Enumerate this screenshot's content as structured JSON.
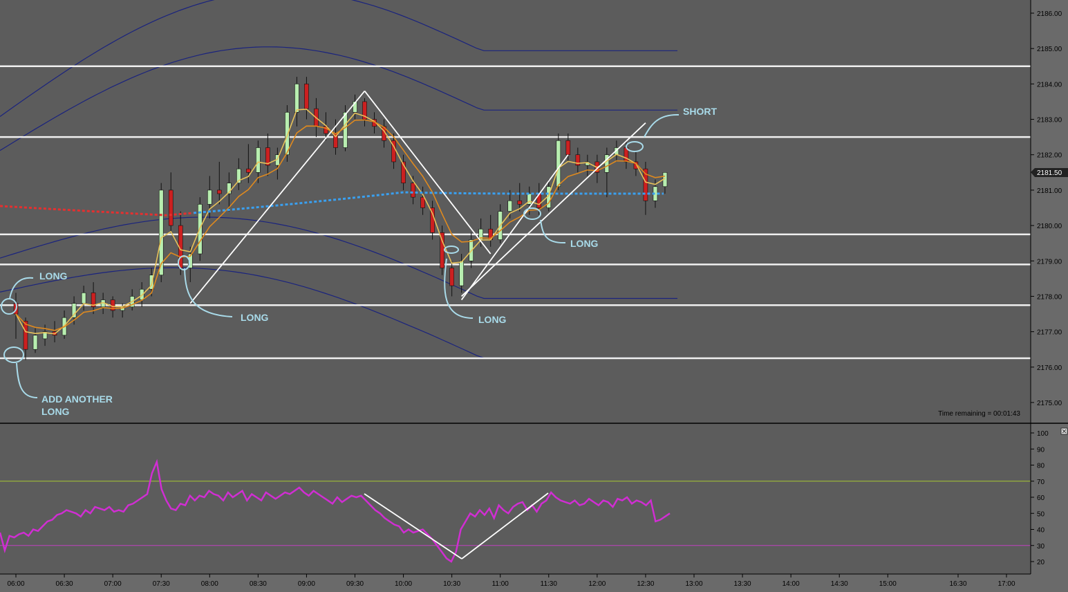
{
  "chart_data": [
    {
      "type": "candlestick",
      "title": "",
      "ylim": [
        2174.5,
        2186.3
      ],
      "x_labels": [
        "06:00",
        "06:30",
        "07:00",
        "07:30",
        "08:00",
        "08:30",
        "09:00",
        "09:30",
        "10:00",
        "10:30",
        "11:00",
        "11:30",
        "12:00",
        "12:30",
        "13:00",
        "13:30",
        "14:00",
        "14:30",
        "15:00",
        "16:30",
        "17:00"
      ],
      "y_ticks": [
        "2175.00",
        "2176.00",
        "2177.00",
        "2178.00",
        "2179.00",
        "2180.00",
        "2181.00",
        "2182.00",
        "2183.00",
        "2184.00",
        "2185.00",
        "2186.00"
      ],
      "last_price": "2181.50",
      "status_text": "Time remaining = 00:01:43",
      "horizontal_levels": [
        2184.5,
        2182.5,
        2179.75,
        2178.9,
        2177.75,
        2176.25
      ],
      "annotations": [
        "LONG",
        "LONG",
        "ADD ANOTHER",
        "LONG",
        "LONG",
        "LONG",
        "SHORT"
      ],
      "bars": [
        [
          "06:00",
          2177.8,
          2178.1,
          2176.8,
          2177.5
        ],
        [
          "06:06",
          2177.3,
          2177.4,
          2176.2,
          2176.5
        ],
        [
          "06:12",
          2176.5,
          2177.1,
          2176.4,
          2176.9
        ],
        [
          "06:18",
          2176.8,
          2177.2,
          2176.6,
          2177.0
        ],
        [
          "06:24",
          2177.0,
          2177.3,
          2176.7,
          2176.9
        ],
        [
          "06:30",
          2176.9,
          2177.6,
          2176.8,
          2177.4
        ],
        [
          "06:36",
          2177.4,
          2178.0,
          2177.2,
          2177.8
        ],
        [
          "06:42",
          2177.8,
          2178.3,
          2177.6,
          2178.1
        ],
        [
          "06:48",
          2178.1,
          2178.4,
          2177.5,
          2177.7
        ],
        [
          "06:54",
          2177.7,
          2178.1,
          2177.5,
          2177.9
        ],
        [
          "07:00",
          2177.9,
          2178.0,
          2177.4,
          2177.6
        ],
        [
          "07:06",
          2177.6,
          2177.8,
          2177.4,
          2177.7
        ],
        [
          "07:12",
          2177.7,
          2178.2,
          2177.6,
          2178.0
        ],
        [
          "07:18",
          2177.9,
          2178.4,
          2177.7,
          2178.2
        ],
        [
          "07:24",
          2178.2,
          2178.8,
          2178.0,
          2178.6
        ],
        [
          "07:30",
          2178.6,
          2181.2,
          2178.4,
          2181.0
        ],
        [
          "07:36",
          2181.0,
          2181.5,
          2179.8,
          2180.0
        ],
        [
          "07:42",
          2180.0,
          2180.4,
          2178.6,
          2178.8
        ],
        [
          "07:48",
          2178.8,
          2179.4,
          2178.4,
          2179.2
        ],
        [
          "07:54",
          2179.2,
          2180.8,
          2179.0,
          2180.6
        ],
        [
          "08:00",
          2180.6,
          2181.4,
          2180.2,
          2181.0
        ],
        [
          "08:06",
          2181.0,
          2181.8,
          2180.6,
          2180.9
        ],
        [
          "08:12",
          2180.9,
          2181.5,
          2180.4,
          2181.2
        ],
        [
          "08:18",
          2181.2,
          2181.9,
          2181.0,
          2181.6
        ],
        [
          "08:24",
          2181.6,
          2182.3,
          2181.2,
          2181.5
        ],
        [
          "08:30",
          2181.5,
          2182.4,
          2181.2,
          2182.2
        ],
        [
          "08:36",
          2182.2,
          2182.6,
          2181.4,
          2181.7
        ],
        [
          "08:42",
          2181.7,
          2182.2,
          2181.3,
          2182.0
        ],
        [
          "08:48",
          2182.0,
          2183.4,
          2181.8,
          2183.2
        ],
        [
          "08:54",
          2183.2,
          2184.2,
          2182.8,
          2184.0
        ],
        [
          "09:00",
          2184.0,
          2184.2,
          2183.0,
          2183.3
        ],
        [
          "09:06",
          2183.3,
          2183.6,
          2182.5,
          2182.8
        ],
        [
          "09:12",
          2182.8,
          2183.2,
          2182.4,
          2182.6
        ],
        [
          "09:18",
          2182.6,
          2183.0,
          2182.0,
          2182.2
        ],
        [
          "09:24",
          2182.2,
          2183.4,
          2182.1,
          2183.2
        ],
        [
          "09:30",
          2183.2,
          2183.7,
          2183.0,
          2183.5
        ],
        [
          "09:36",
          2183.5,
          2183.6,
          2182.8,
          2183.0
        ],
        [
          "09:42",
          2183.0,
          2183.2,
          2182.6,
          2182.8
        ],
        [
          "09:48",
          2182.8,
          2183.0,
          2182.2,
          2182.4
        ],
        [
          "09:54",
          2182.4,
          2182.6,
          2181.6,
          2181.8
        ],
        [
          "10:00",
          2181.8,
          2182.0,
          2181.0,
          2181.2
        ],
        [
          "10:06",
          2181.2,
          2181.4,
          2180.6,
          2180.8
        ],
        [
          "10:12",
          2180.8,
          2181.1,
          2180.3,
          2180.5
        ],
        [
          "10:18",
          2180.5,
          2180.7,
          2179.6,
          2179.8
        ],
        [
          "10:24",
          2179.8,
          2180.0,
          2178.6,
          2178.8
        ],
        [
          "10:30",
          2178.8,
          2179.0,
          2178.0,
          2178.3
        ],
        [
          "10:36",
          2178.3,
          2179.2,
          2178.1,
          2179.0
        ],
        [
          "10:42",
          2179.0,
          2179.8,
          2178.8,
          2179.6
        ],
        [
          "10:48",
          2179.6,
          2180.2,
          2179.4,
          2179.9
        ],
        [
          "10:54",
          2179.9,
          2180.3,
          2179.4,
          2179.6
        ],
        [
          "11:00",
          2179.6,
          2180.6,
          2179.5,
          2180.4
        ],
        [
          "11:06",
          2180.4,
          2181.0,
          2180.2,
          2180.7
        ],
        [
          "11:12",
          2180.7,
          2181.2,
          2180.4,
          2180.6
        ],
        [
          "11:18",
          2180.6,
          2181.1,
          2180.3,
          2180.9
        ],
        [
          "11:24",
          2180.9,
          2181.2,
          2180.3,
          2180.5
        ],
        [
          "11:30",
          2180.5,
          2181.3,
          2180.4,
          2181.1
        ],
        [
          "11:36",
          2181.1,
          2182.6,
          2181.0,
          2182.4
        ],
        [
          "11:42",
          2182.4,
          2182.6,
          2181.8,
          2182.0
        ],
        [
          "11:48",
          2182.0,
          2182.2,
          2181.5,
          2181.7
        ],
        [
          "11:54",
          2181.7,
          2182.0,
          2181.4,
          2181.8
        ],
        [
          "12:00",
          2181.8,
          2182.0,
          2181.2,
          2181.5
        ],
        [
          "12:06",
          2181.5,
          2182.2,
          2180.8,
          2182.0
        ],
        [
          "12:12",
          2182.0,
          2182.4,
          2181.8,
          2182.2
        ],
        [
          "12:18",
          2182.2,
          2182.4,
          2181.6,
          2181.8
        ],
        [
          "12:24",
          2181.8,
          2182.1,
          2181.4,
          2181.6
        ],
        [
          "12:30",
          2181.6,
          2181.8,
          2180.3,
          2180.7
        ],
        [
          "12:36",
          2180.7,
          2181.3,
          2180.5,
          2181.1
        ],
        [
          "12:42",
          2181.1,
          2181.5,
          2180.9,
          2181.5
        ]
      ]
    },
    {
      "type": "line",
      "ylim": [
        14,
        104
      ],
      "y_ticks": [
        "20",
        "30",
        "40",
        "50",
        "60",
        "70",
        "80",
        "90",
        "100"
      ],
      "levels": [
        70,
        30
      ],
      "series": [
        {
          "values": [
            38,
            27,
            36,
            35,
            37,
            38,
            36,
            40,
            39,
            42,
            45,
            46,
            49,
            50,
            52,
            51,
            50,
            48,
            52,
            50,
            54,
            53,
            52,
            54,
            51,
            52,
            51,
            55,
            56,
            58,
            60,
            62,
            75,
            82,
            65,
            58,
            53,
            52,
            56,
            55,
            61,
            58,
            61,
            60,
            64,
            62,
            61,
            58,
            63,
            60,
            62,
            64,
            58,
            62,
            60,
            58,
            63,
            61,
            59,
            61,
            63,
            62,
            64,
            66,
            63,
            61,
            64,
            62,
            60,
            58,
            56,
            60,
            57,
            59,
            61,
            60,
            61,
            58,
            55,
            52,
            50,
            47,
            45,
            43,
            42,
            38,
            40,
            38,
            39,
            40,
            37,
            34,
            30,
            26,
            22,
            20,
            26,
            40,
            45,
            50,
            48,
            52,
            49,
            53,
            47,
            55,
            52,
            50,
            54,
            56,
            57,
            52,
            55,
            51,
            56,
            58,
            63,
            60,
            58,
            57,
            56,
            58,
            55,
            56,
            59,
            57,
            55,
            58,
            57,
            54,
            59,
            58,
            60,
            56,
            58,
            57,
            55,
            58,
            45,
            46,
            48,
            50
          ]
        }
      ]
    }
  ]
}
